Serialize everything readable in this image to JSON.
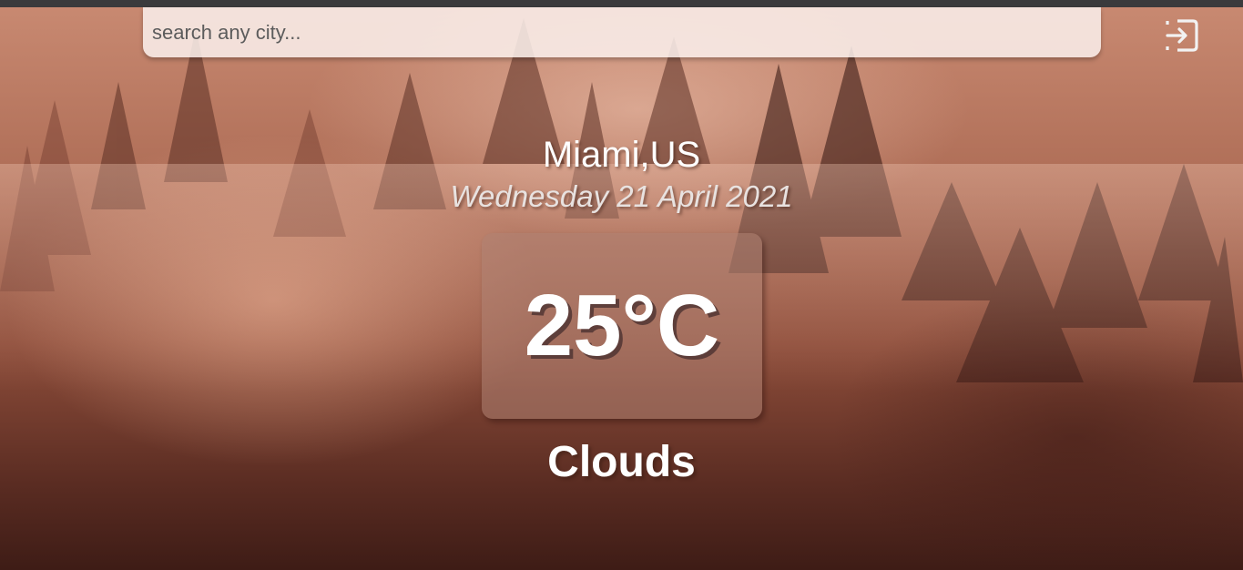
{
  "search": {
    "placeholder": "search any city..."
  },
  "header": {
    "logout_icon": "exit-arrow-icon"
  },
  "weather": {
    "location": "Miami,US",
    "date": "Wednesday 21 April 2021",
    "temperature": "25°C",
    "condition": "Clouds"
  },
  "theme": {
    "background": "misty forest sunrise",
    "accent": "#ffffff",
    "search_bg": "#f9ede8"
  }
}
